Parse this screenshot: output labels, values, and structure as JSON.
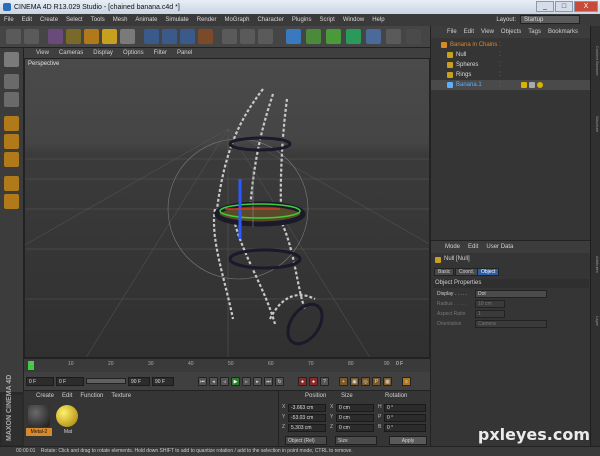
{
  "window": {
    "title": "CINEMA 4D R13.029 Studio - [chained banana.c4d *]",
    "minimize": "_",
    "maximize": "□",
    "close": "X"
  },
  "menubar": {
    "items": [
      "File",
      "Edit",
      "Create",
      "Select",
      "Tools",
      "Mesh",
      "Animate",
      "Simulate",
      "Render",
      "MoGraph",
      "Character",
      "Plugins",
      "Script",
      "Window",
      "Help"
    ],
    "layout_label": "Layout:",
    "layout_value": "Startup"
  },
  "viewport": {
    "menu": [
      "View",
      "Cameras",
      "Display",
      "Options",
      "Filter",
      "Panel"
    ],
    "label": "Perspective"
  },
  "timeline": {
    "ticks": [
      "0",
      "10",
      "20",
      "30",
      "40",
      "50",
      "60",
      "70",
      "80",
      "90"
    ],
    "current_frame": "0 F",
    "start": "0 F",
    "preview_start": "0 F",
    "preview_end": "90 F",
    "end": "90 F"
  },
  "materials": {
    "menu": [
      "Create",
      "Edit",
      "Function",
      "Texture"
    ],
    "items": [
      {
        "name": "Metal-2",
        "color": "#1a1a1a"
      },
      {
        "name": "Mat",
        "color": "#d8b300"
      }
    ],
    "brand": "MAXON CINEMA 4D"
  },
  "coordinates": {
    "headers": [
      "Position",
      "Size",
      "Rotation"
    ],
    "rows": [
      {
        "axis": "X",
        "pos": "-3.663 cm",
        "size_axis": "X",
        "size": "0 cm",
        "rot_axis": "H",
        "rot": "0 °"
      },
      {
        "axis": "Y",
        "pos": "-53.03 cm",
        "size_axis": "Y",
        "size": "0 cm",
        "rot_axis": "P",
        "rot": "0 °"
      },
      {
        "axis": "Z",
        "pos": "5.303 cm",
        "size_axis": "Z",
        "size": "0 cm",
        "rot_axis": "B",
        "rot": "0 °"
      }
    ],
    "mode": "Object (Rel)",
    "size_mode": "Size",
    "apply": "Apply"
  },
  "object_manager": {
    "menu": [
      "File",
      "Edit",
      "View",
      "Objects",
      "Tags",
      "Bookmarks"
    ],
    "objects": [
      {
        "name": "Banana in Chains",
        "indent": 0,
        "selected": false,
        "color": "#d88a2a"
      },
      {
        "name": "Null",
        "indent": 1,
        "selected": false,
        "color": "#d8d8d8"
      },
      {
        "name": "Spheres",
        "indent": 1,
        "selected": false,
        "color": "#d8d8d8"
      },
      {
        "name": "Rings",
        "indent": 1,
        "selected": false,
        "color": "#d8d8d8"
      },
      {
        "name": "Banana.1",
        "indent": 1,
        "selected": true,
        "color": "#5ab0ff"
      }
    ]
  },
  "attributes": {
    "menu": [
      "Mode",
      "Edit",
      "User Data"
    ],
    "object_title": "Null [Null]",
    "tabs": [
      "Basic",
      "Coord.",
      "Object"
    ],
    "active_tab": "Object",
    "section": "Object Properties",
    "props": [
      {
        "label": "Display . . . . .",
        "value": "Dot",
        "enabled": true
      },
      {
        "label": "Radius . . . . .",
        "value": "10 cm",
        "enabled": false
      },
      {
        "label": "Aspect Ratio",
        "value": "1",
        "enabled": false
      },
      {
        "label": "Orientation",
        "value": "Camera",
        "enabled": false
      }
    ]
  },
  "statusbar": {
    "time": "00:00:01",
    "text": "Rotate: Click and drag to rotate elements. Hold down SHIFT to add to quantize rotation / add to the selection in point mode, CTRL to remove."
  },
  "right_strip": [
    "Content Browser",
    "Structure",
    "Attributes",
    "Layer"
  ],
  "watermark": "pxleyes.com"
}
